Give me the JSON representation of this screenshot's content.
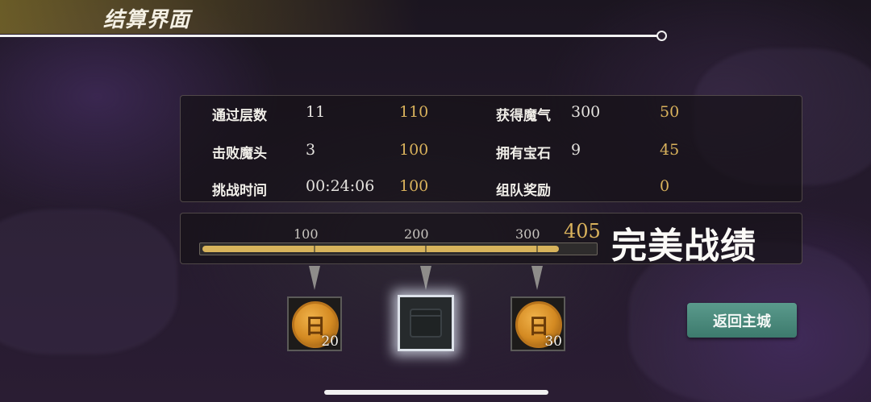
{
  "header": {
    "title": "结算界面"
  },
  "stats": {
    "rows": [
      {
        "label": "通过层数",
        "value": "11",
        "score": "110"
      },
      {
        "label": "击败魔头",
        "value": "3",
        "score": "100"
      },
      {
        "label": "挑战时间",
        "value": "00:24:06",
        "score": "100"
      },
      {
        "label": "获得魔气",
        "value": "300",
        "score": "50"
      },
      {
        "label": "拥有宝石",
        "value": "9",
        "score": "45"
      },
      {
        "label": "组队奖励",
        "value": "",
        "score": "0"
      }
    ]
  },
  "progress": {
    "ticks": [
      "100",
      "200",
      "300"
    ],
    "total_score": "405",
    "fill_fraction": 0.91,
    "rating": "完美战绩"
  },
  "rewards": [
    {
      "icon": "gold-coin-icon",
      "count": "20"
    },
    {
      "icon": "treasure-chest-icon",
      "count": ""
    },
    {
      "icon": "gold-coin-icon",
      "count": "30"
    }
  ],
  "actions": {
    "return_label": "返回主城"
  },
  "colors": {
    "accent_gold": "#d9b25c",
    "button_teal": "#4a8a7c"
  }
}
